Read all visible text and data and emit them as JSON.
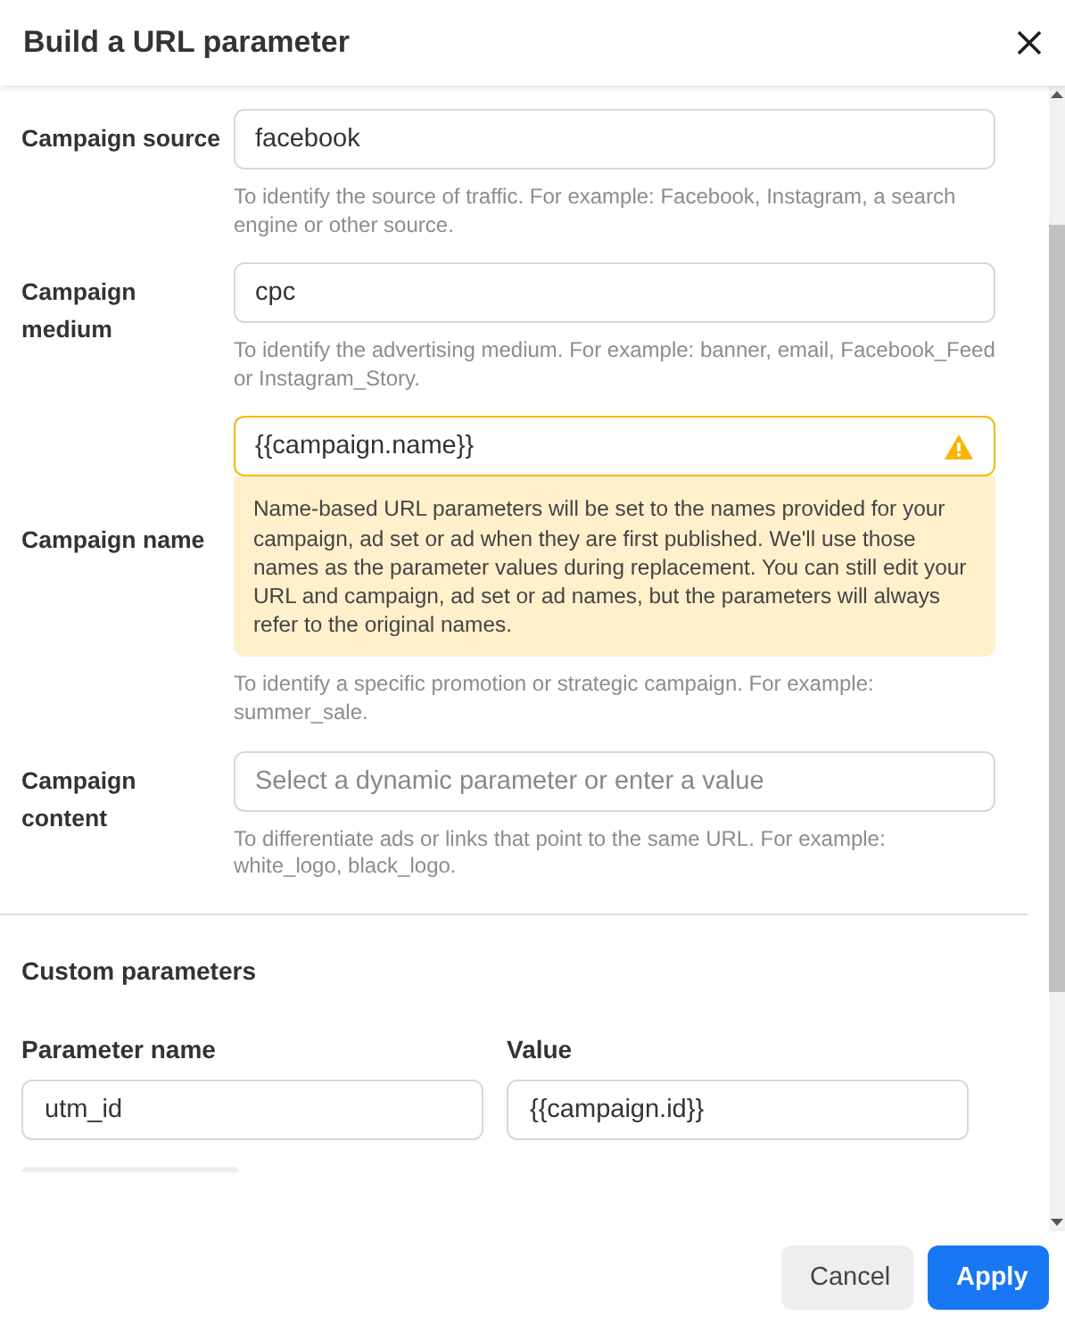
{
  "dialog": {
    "title": "Build a URL parameter"
  },
  "fields": [
    {
      "label": "Campaign source",
      "value": "facebook",
      "help": "To identify the source of traffic. For example: Facebook, Instagram, a search engine or other source."
    },
    {
      "label": "Campaign medium",
      "value": "cpc",
      "help": "To identify the advertising medium. For example: banner, email, Facebook_Feed or Instagram_Story."
    },
    {
      "label": "Campaign name",
      "value": "{{campaign.name}}",
      "warning": "Name-based URL parameters will be set to the names provided for your campaign, ad set or ad when they are first published. We'll use those names as the parameter values during replacement. You can still edit your URL and campaign, ad set or ad names, but the parameters will always refer to the original names.",
      "help": "To identify a specific promotion or strategic campaign. For example: summer_sale."
    },
    {
      "label": "Campaign content",
      "placeholder": "Select a dynamic parameter or enter a value",
      "help": "To differentiate ads or links that point to the same URL. For example: white_logo, black_logo."
    }
  ],
  "custom_parameters": {
    "title": "Custom parameters",
    "columns": [
      "Parameter name",
      "Value"
    ],
    "rows": [
      {
        "name": "utm_id",
        "value": "{{campaign.id}}"
      }
    ]
  },
  "buttons": [
    {
      "label": "Cancel",
      "kind": "secondary"
    },
    {
      "label": "Apply",
      "kind": "primary"
    }
  ]
}
